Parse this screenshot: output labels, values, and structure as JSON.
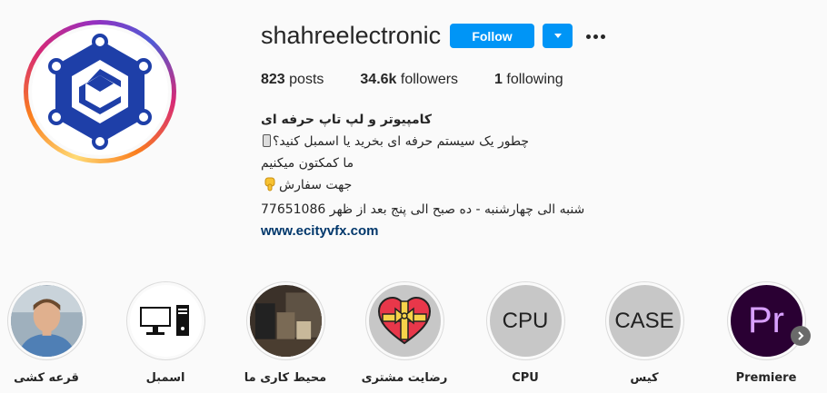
{
  "profile": {
    "username": "shahreelectronic",
    "follow_label": "Follow",
    "stats": [
      {
        "value": "823",
        "label": "posts"
      },
      {
        "value": "34.6k",
        "label": "followers"
      },
      {
        "value": "1",
        "label": "following"
      }
    ],
    "bio": {
      "name": "کامپیوتر و لپ تاپ حرفه ای",
      "line1": "چطور یک سیستم حرفه ای بخرید یا اسمبل کنید؟",
      "line2": "ما کمکتون میکنیم",
      "line3": "جهت سفارش",
      "line4": "شنبه الی چهارشنبه - ده صبح الی پنج بعد از ظهر 77651086",
      "link": "www.ecityvfx.com"
    }
  },
  "highlights": [
    {
      "label": "قرعه کشی",
      "icon": "person-photo"
    },
    {
      "label": "اسمبل",
      "icon": "desktop-computer-icon"
    },
    {
      "label": "محیط کاری ما",
      "icon": "workspace-photo"
    },
    {
      "label": "رضایت مشتری",
      "icon": "heart-gift-icon"
    },
    {
      "label": "CPU",
      "text": "CPU"
    },
    {
      "label": "کیس",
      "text": "CASE"
    },
    {
      "label": "Premiere",
      "icon": "premiere-logo",
      "logo_text": "Pr"
    }
  ],
  "colors": {
    "follow_button": "#0095f6",
    "link": "#00376b",
    "logo_blue": "#1e3fa8",
    "premiere_purple": "#9999ff"
  }
}
